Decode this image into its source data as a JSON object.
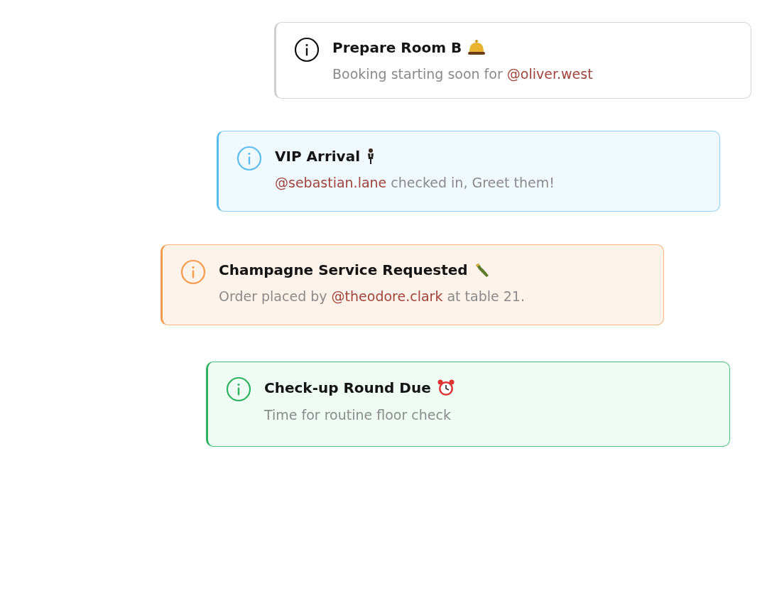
{
  "notifications": [
    {
      "kind": "neutral",
      "title": "Prepare Room B",
      "message": [
        {
          "text": "Booking starting soon for ",
          "mention": false
        },
        {
          "text": "@oliver.west",
          "mention": true
        }
      ]
    },
    {
      "kind": "info",
      "title": "VIP Arrival",
      "message": [
        {
          "text": "@sebastian.lane",
          "mention": true
        },
        {
          "text": " checked in, Greet them!",
          "mention": false
        }
      ]
    },
    {
      "kind": "warning",
      "title": "Champagne Service Requested",
      "message": [
        {
          "text": "Order placed by ",
          "mention": false
        },
        {
          "text": "@theodore.clark",
          "mention": true
        },
        {
          "text": " at table 21.",
          "mention": false
        }
      ]
    },
    {
      "kind": "success",
      "title": "Check-up Round Due",
      "message": [
        {
          "text": "Time for routine floor check",
          "mention": false
        }
      ]
    }
  ]
}
